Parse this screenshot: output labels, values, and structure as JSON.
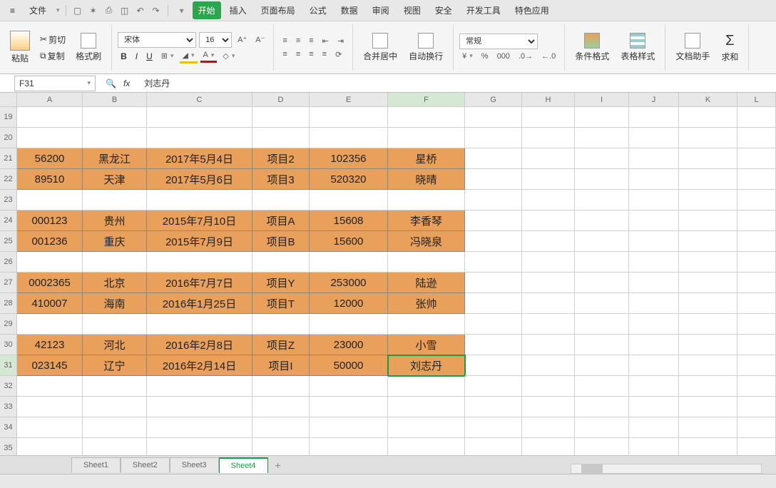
{
  "menu": {
    "file": "文件",
    "items": [
      "开始",
      "插入",
      "页面布局",
      "公式",
      "数据",
      "审阅",
      "视图",
      "安全",
      "开发工具",
      "特色应用"
    ],
    "activeIndex": 0
  },
  "qat": {
    "icons": [
      "new",
      "open",
      "print",
      "preview",
      "undo",
      "redo"
    ]
  },
  "ribbon": {
    "paste": "粘贴",
    "cut": "剪切",
    "copy": "复制",
    "fmtpaint": "格式刷",
    "font": "宋体",
    "fontsize": "16",
    "merge": "合并居中",
    "wrap": "自动换行",
    "numfmt": "常规",
    "condfmt": "条件格式",
    "tblstyle": "表格样式",
    "dochelp": "文档助手",
    "sum": "求和"
  },
  "formula": {
    "namebox": "F31",
    "fx": "fx",
    "value": "刘志丹"
  },
  "cols": [
    "A",
    "B",
    "C",
    "D",
    "E",
    "F",
    "G",
    "H",
    "I",
    "J",
    "K",
    "L"
  ],
  "activeCol": "F",
  "rows": [
    "19",
    "20",
    "21",
    "22",
    "23",
    "24",
    "25",
    "26",
    "27",
    "28",
    "29",
    "30",
    "31",
    "32",
    "33",
    "34",
    "35"
  ],
  "activeRow": "31",
  "chart_data": {
    "type": "table",
    "columns": [
      "A",
      "B",
      "C",
      "D",
      "E",
      "F"
    ],
    "firstVisibleRow": 19,
    "rows": [
      {
        "r": 21,
        "A": "56200",
        "B": "黑龙江",
        "C": "2017年5月4日",
        "D": "项目2",
        "E": "102356",
        "F": "星桥"
      },
      {
        "r": 22,
        "A": "89510",
        "B": "天津",
        "C": "2017年5月6日",
        "D": "项目3",
        "E": "520320",
        "F": "晓晴"
      },
      {
        "r": 24,
        "A": "000123",
        "B": "贵州",
        "C": "2015年7月10日",
        "D": "项目A",
        "E": "15608",
        "F": "李香琴"
      },
      {
        "r": 25,
        "A": "001236",
        "B": "重庆",
        "C": "2015年7月9日",
        "D": "项目B",
        "E": "15600",
        "F": "冯晓泉"
      },
      {
        "r": 27,
        "A": "0002365",
        "B": "北京",
        "C": "2016年7月7日",
        "D": "项目Y",
        "E": "253000",
        "F": "陆逊"
      },
      {
        "r": 28,
        "A": "410007",
        "B": "海南",
        "C": "2016年1月25日",
        "D": "项目T",
        "E": "12000",
        "F": "张帅"
      },
      {
        "r": 30,
        "A": "42123",
        "B": "河北",
        "C": "2016年2月8日",
        "D": "项目Z",
        "E": "23000",
        "F": "小雪"
      },
      {
        "r": 31,
        "A": "023145",
        "B": "辽宁",
        "C": "2016年2月14日",
        "D": "项目I",
        "E": "50000",
        "F": "刘志丹"
      }
    ],
    "selection": "F31"
  },
  "sheets": {
    "list": [
      "Sheet1",
      "Sheet2",
      "Sheet3",
      "Sheet4"
    ],
    "active": 3
  }
}
